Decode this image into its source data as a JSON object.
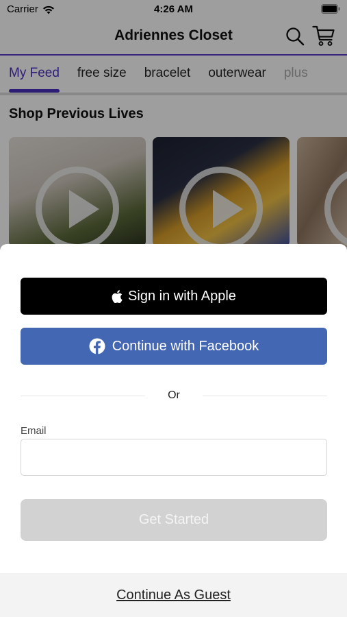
{
  "status_bar": {
    "carrier": "Carrier",
    "time": "4:26 AM",
    "icons": [
      "wifi-icon",
      "battery-icon"
    ]
  },
  "nav": {
    "title": "Adriennes Closet",
    "icons": [
      "search-icon",
      "cart-icon"
    ],
    "accent_color": "#4a2fc0"
  },
  "tabs": [
    {
      "label": "My Feed",
      "active": true
    },
    {
      "label": "free size",
      "active": false
    },
    {
      "label": "bracelet",
      "active": false
    },
    {
      "label": "outerwear",
      "active": false
    },
    {
      "label": "plus",
      "active": false
    }
  ],
  "section": {
    "title": "Shop Previous Lives"
  },
  "sheet": {
    "apple_label": "Sign in with Apple",
    "facebook_label": "Continue with Facebook",
    "facebook_color": "#4467b4",
    "or_label": "Or",
    "email_label": "Email",
    "email_value": "",
    "email_placeholder": "",
    "get_started_label": "Get Started",
    "guest_label": "Continue As Guest"
  }
}
